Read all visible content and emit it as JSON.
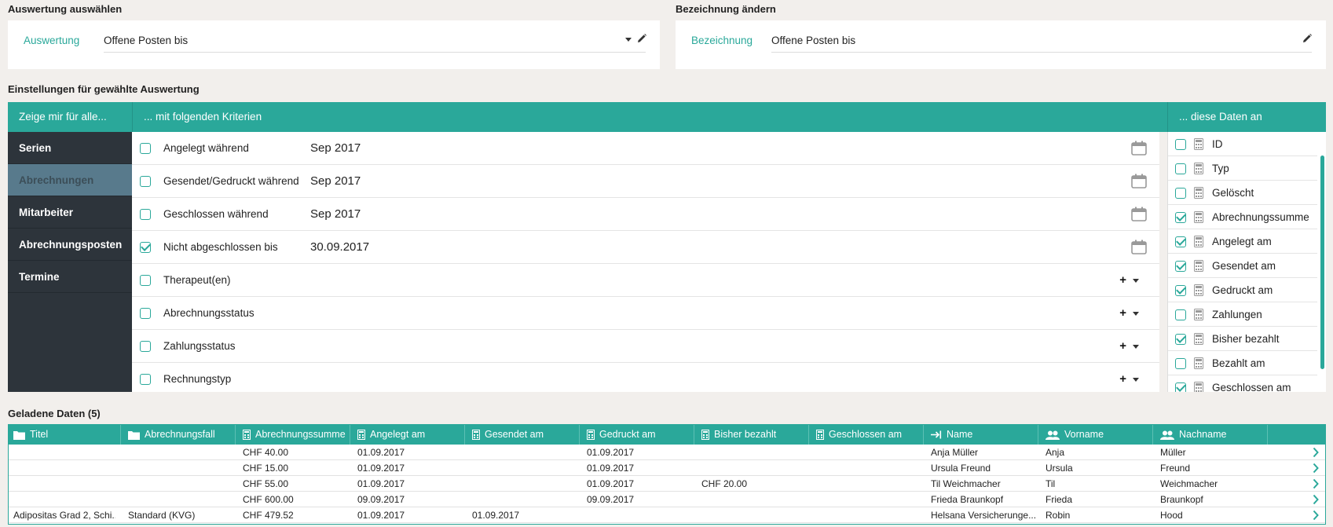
{
  "select_section": {
    "title": "Auswertung auswählen",
    "label": "Auswertung",
    "value": "Offene Posten bis"
  },
  "rename_section": {
    "title": "Bezeichnung ändern",
    "label": "Bezeichnung",
    "value": "Offene Posten bis"
  },
  "settings_title": "Einstellungen für gewählte Auswertung",
  "headers": {
    "left": "Zeige mir für alle...",
    "middle": "... mit folgenden Kriterien",
    "right": "... diese Daten an"
  },
  "nav_items": [
    "Serien",
    "Abrechnungen",
    "Mitarbeiter",
    "Abrechnungsposten",
    "Termine"
  ],
  "nav_active": "Abrechnungen",
  "criteria": [
    {
      "label": "Angelegt während",
      "value": "Sep 2017",
      "checked": false,
      "control": "calendar"
    },
    {
      "label": "Gesendet/Gedruckt während",
      "value": "Sep 2017",
      "checked": false,
      "control": "calendar"
    },
    {
      "label": "Geschlossen während",
      "value": "Sep 2017",
      "checked": false,
      "control": "calendar"
    },
    {
      "label": "Nicht abgeschlossen bis",
      "value": "30.09.2017",
      "checked": true,
      "control": "calendar"
    },
    {
      "label": "Therapeut(en)",
      "value": "",
      "checked": false,
      "control": "add"
    },
    {
      "label": "Abrechnungsstatus",
      "value": "",
      "checked": false,
      "control": "add"
    },
    {
      "label": "Zahlungsstatus",
      "value": "",
      "checked": false,
      "control": "add"
    },
    {
      "label": "Rechnungstyp",
      "value": "",
      "checked": false,
      "control": "add"
    }
  ],
  "data_fields": [
    {
      "label": "ID",
      "checked": false
    },
    {
      "label": "Typ",
      "checked": false
    },
    {
      "label": "Gelöscht",
      "checked": false
    },
    {
      "label": "Abrechnungssumme",
      "checked": true
    },
    {
      "label": "Angelegt am",
      "checked": true
    },
    {
      "label": "Gesendet am",
      "checked": true
    },
    {
      "label": "Gedruckt am",
      "checked": true
    },
    {
      "label": "Zahlungen",
      "checked": false
    },
    {
      "label": "Bisher bezahlt",
      "checked": true
    },
    {
      "label": "Bezahlt am",
      "checked": false
    },
    {
      "label": "Geschlossen am",
      "checked": true
    }
  ],
  "loaded_title": "Geladene Daten (5)",
  "grid": {
    "columns": [
      {
        "label": "Titel",
        "icon": "folder-icon"
      },
      {
        "label": "Abrechnungsfall",
        "icon": "folder-icon"
      },
      {
        "label": "Abrechnungssumme",
        "icon": "calculator-icon"
      },
      {
        "label": "Angelegt am",
        "icon": "calculator-icon"
      },
      {
        "label": "Gesendet am",
        "icon": "calculator-icon"
      },
      {
        "label": "Gedruckt am",
        "icon": "calculator-icon"
      },
      {
        "label": "Bisher bezahlt",
        "icon": "calculator-icon"
      },
      {
        "label": "Geschlossen am",
        "icon": "calculator-icon"
      },
      {
        "label": "Name",
        "icon": "arrow-to-icon"
      },
      {
        "label": "Vorname",
        "icon": "users-icon"
      },
      {
        "label": "Nachname",
        "icon": "users-icon"
      }
    ],
    "rows": [
      [
        "",
        "",
        "CHF 40.00",
        "01.09.2017",
        "",
        "01.09.2017",
        "",
        "",
        "Anja Müller",
        "Anja",
        "Müller"
      ],
      [
        "",
        "",
        "CHF 15.00",
        "01.09.2017",
        "",
        "01.09.2017",
        "",
        "",
        "Ursula Freund",
        "Ursula",
        "Freund"
      ],
      [
        "",
        "",
        "CHF 55.00",
        "01.09.2017",
        "",
        "01.09.2017",
        "CHF 20.00",
        "",
        "Til Weichmacher",
        "Til",
        "Weichmacher"
      ],
      [
        "",
        "",
        "CHF 600.00",
        "09.09.2017",
        "",
        "09.09.2017",
        "",
        "",
        "Frieda Braunkopf",
        "Frieda",
        "Braunkopf"
      ],
      [
        "Adipositas Grad 2, Schi...",
        "Standard (KVG)",
        "CHF 479.52",
        "01.09.2017",
        "01.09.2017",
        "",
        "",
        "",
        "Helsana Versicherunge...",
        "Robin",
        "Hood"
      ]
    ]
  }
}
